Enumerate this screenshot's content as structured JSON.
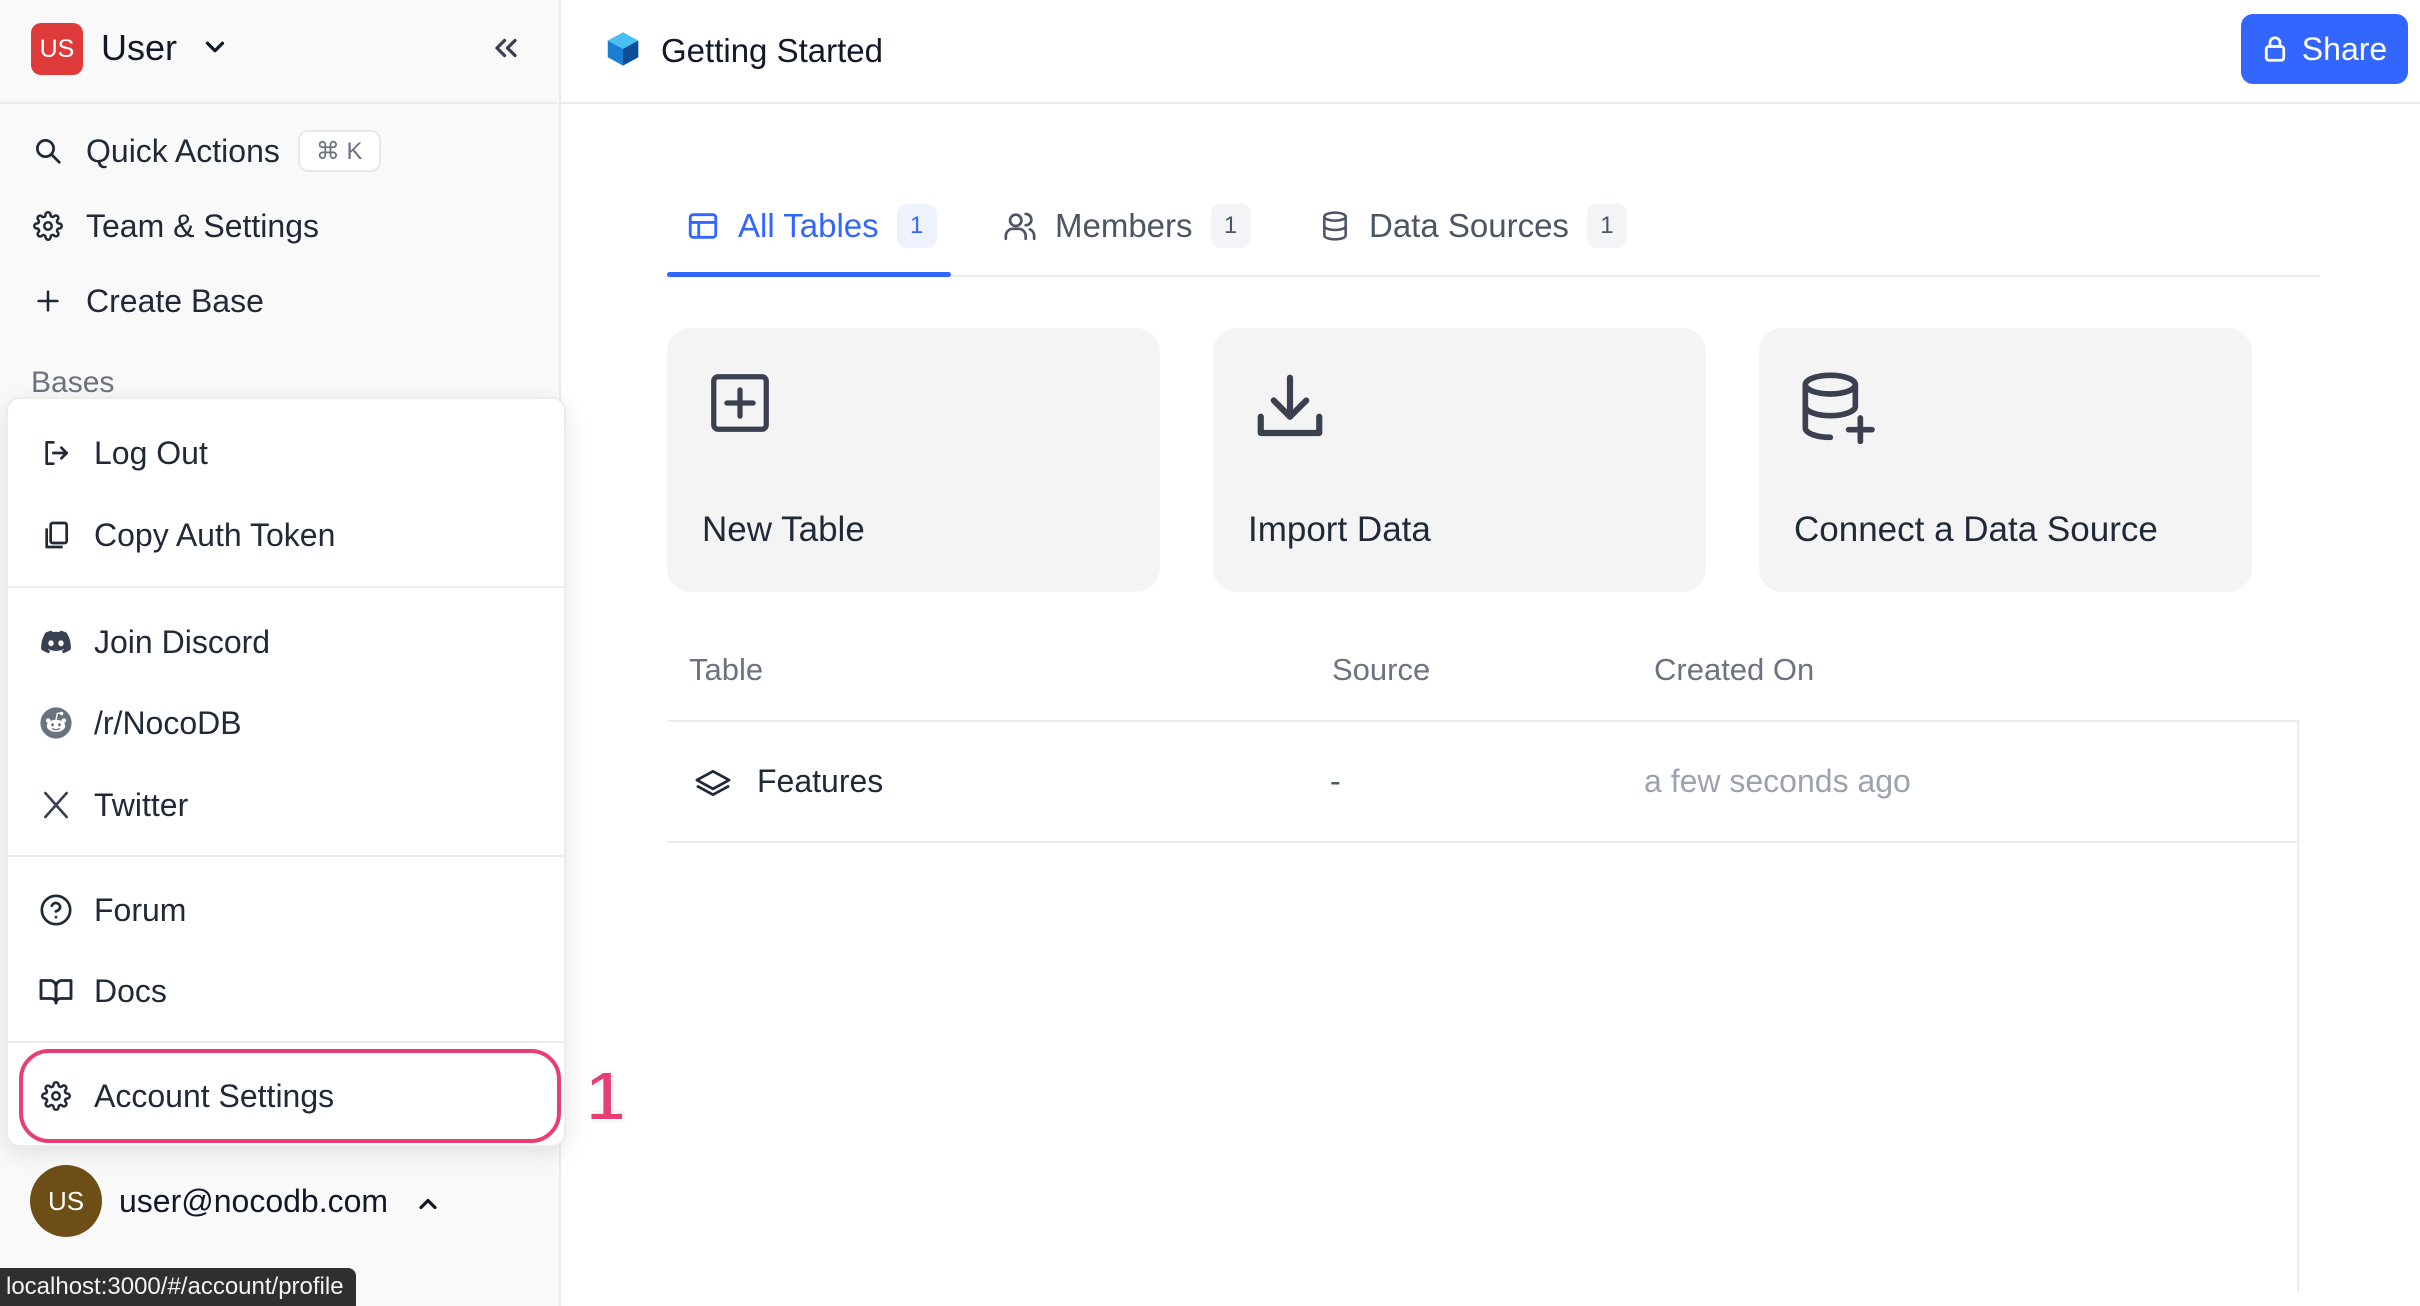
{
  "workspace": {
    "badge": "US",
    "name": "User"
  },
  "sidebar": {
    "quick_actions": "Quick Actions",
    "quick_actions_shortcut": "⌘ K",
    "team_settings": "Team & Settings",
    "create_base": "Create Base",
    "bases_label": "Bases"
  },
  "menu": {
    "log_out": "Log Out",
    "copy_auth_token": "Copy Auth Token",
    "join_discord": "Join Discord",
    "reddit": "/r/NocoDB",
    "twitter": "Twitter",
    "forum": "Forum",
    "docs": "Docs",
    "account_settings": "Account Settings",
    "step_marker": "1"
  },
  "user": {
    "initials": "US",
    "email": "user@nocodb.com"
  },
  "status_bar_url": "localhost:3000/#/account/profile",
  "topbar": {
    "base_title": "Getting Started",
    "share_label": "Share"
  },
  "tabs": [
    {
      "label": "All Tables",
      "count": "1",
      "active": true
    },
    {
      "label": "Members",
      "count": "1",
      "active": false
    },
    {
      "label": "Data Sources",
      "count": "1",
      "active": false
    }
  ],
  "cards": [
    {
      "label": "New Table",
      "icon": "plus-square-icon"
    },
    {
      "label": "Import Data",
      "icon": "download-icon"
    },
    {
      "label": "Connect a Data Source",
      "icon": "database-plus-icon"
    }
  ],
  "table": {
    "columns": [
      "Table",
      "Source",
      "Created On"
    ],
    "rows": [
      {
        "name": "Features",
        "source": "-",
        "created_on": "a few seconds ago"
      }
    ]
  },
  "colors": {
    "accent": "#3366ff",
    "highlight": "#e83e72",
    "workspace_badge": "#df3a3a",
    "avatar": "#6e4e17"
  }
}
